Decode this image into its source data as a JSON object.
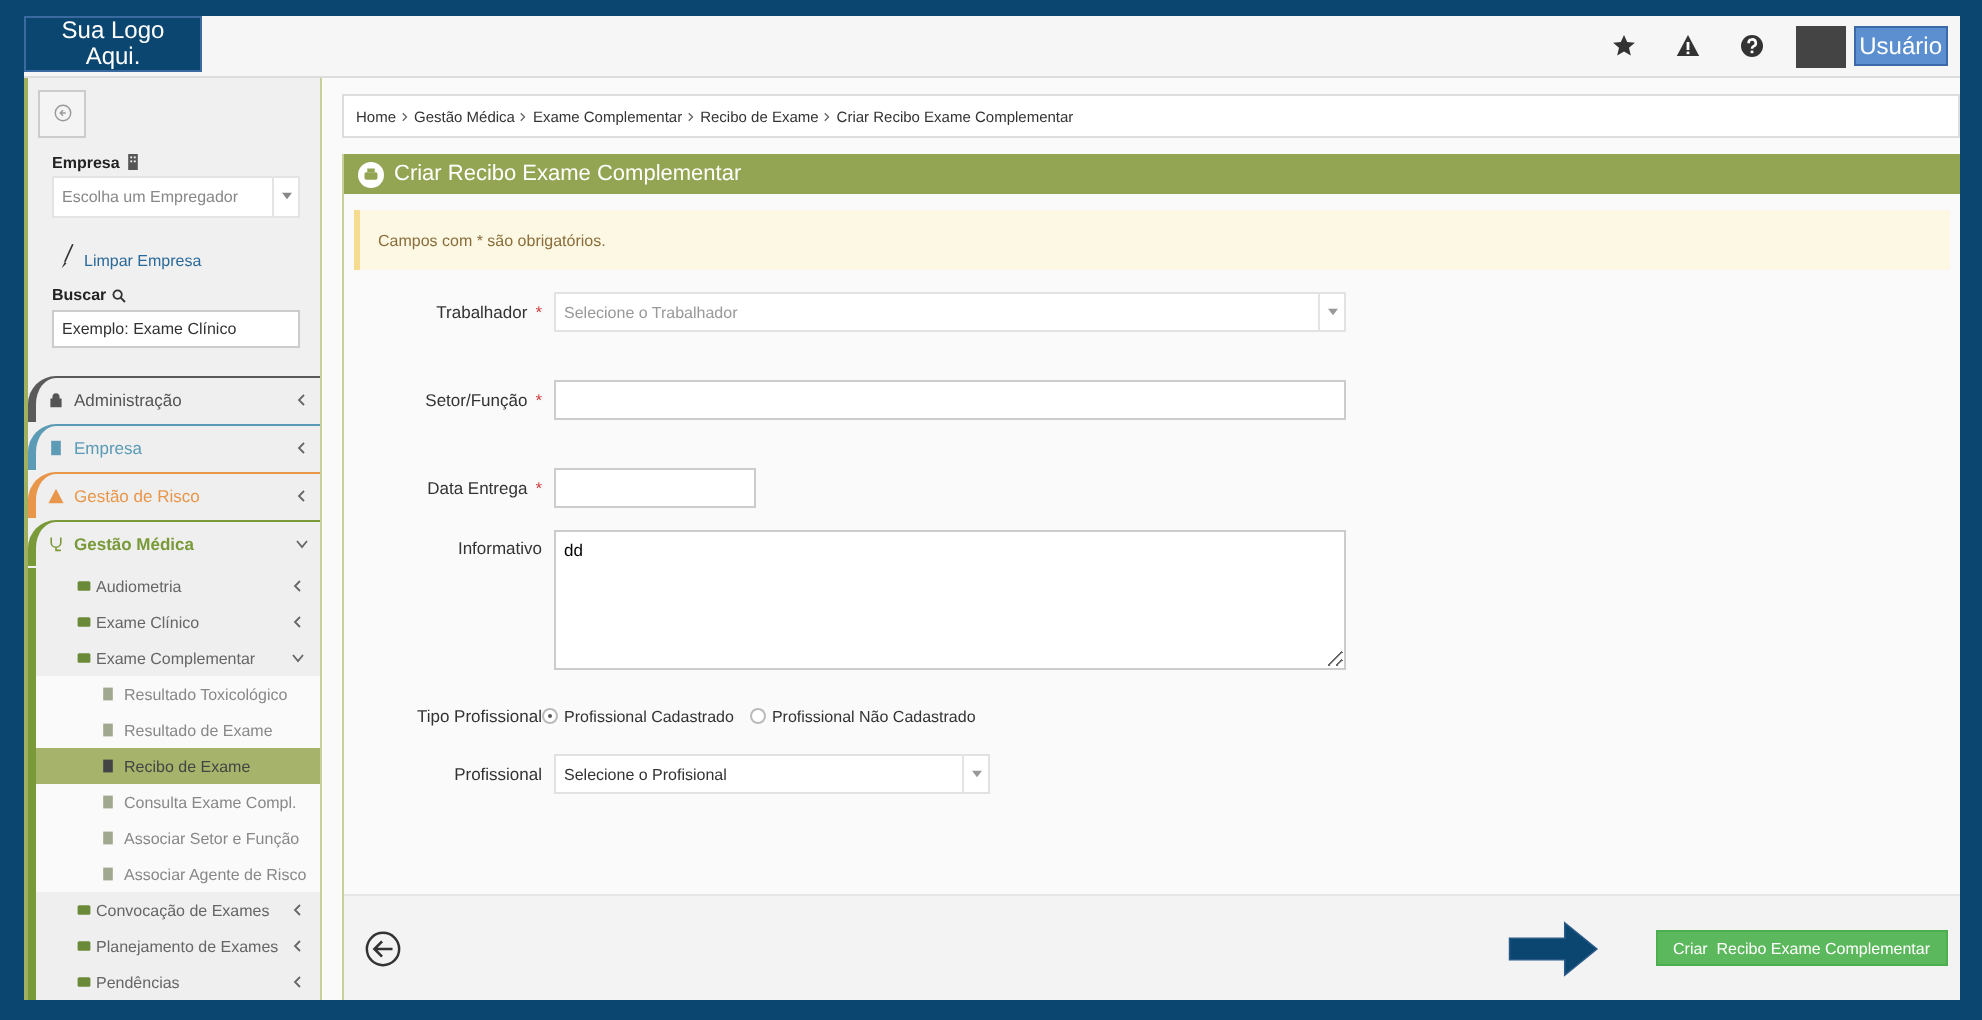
{
  "header": {
    "logo_text": "Sua Logo Aqui.",
    "user_button": "Usuário"
  },
  "sidebar": {
    "company_label": "Empresa",
    "company_select": {
      "placeholder": "Escolha um Empregador"
    },
    "clear_link": "Limpar Empresa",
    "search_label": "Buscar",
    "search": {
      "placeholder": "Exemplo: Exame Clínico"
    },
    "menu": [
      {
        "label": "Administração",
        "color": "#5a5a5a",
        "expanded": false
      },
      {
        "label": "Empresa",
        "color": "#5b9bb5",
        "expanded": false
      },
      {
        "label": "Gestão de Risco",
        "color": "#e8964a",
        "expanded": false
      },
      {
        "label": "Gestão Médica",
        "color": "#7a9a3a",
        "expanded": true,
        "children": [
          {
            "label": "Audiometria",
            "expanded": false
          },
          {
            "label": "Exame Clínico",
            "expanded": false
          },
          {
            "label": "Exame Complementar",
            "expanded": true,
            "children": [
              {
                "label": "Resultado Toxicológico",
                "selected": false
              },
              {
                "label": "Resultado de Exame",
                "selected": false
              },
              {
                "label": "Recibo de Exame",
                "selected": true
              },
              {
                "label": "Consulta Exame Compl.",
                "selected": false
              },
              {
                "label": "Associar Setor e Função",
                "selected": false
              },
              {
                "label": "Associar Agente de Risco",
                "selected": false
              }
            ]
          },
          {
            "label": "Convocação de Exames",
            "expanded": false
          },
          {
            "label": "Planejamento de Exames",
            "expanded": false
          },
          {
            "label": "Pendências",
            "expanded": false
          }
        ]
      }
    ]
  },
  "breadcrumb": [
    "Home",
    "Gestão Médica",
    "Exame Complementar",
    "Recibo de Exame",
    "Criar Recibo Exame Complementar"
  ],
  "panel_title": "Criar Recibo Exame Complementar",
  "alert": "Campos com * são obrigatórios.",
  "form": [
    {
      "kind": "select",
      "label": "Trabalhador",
      "required_mark": "*",
      "placeholder": "Selecione o Trabalhador"
    },
    {
      "kind": "text",
      "label": "Setor/Função",
      "required_mark": "*"
    },
    {
      "kind": "date",
      "label": "Data Entrega",
      "required_mark": "*"
    },
    {
      "kind": "textarea",
      "label": "Informativo",
      "value": "dd"
    },
    {
      "kind": "radio",
      "label": "Tipo Profissional",
      "options": [
        {
          "label": "Profissional Cadastrado",
          "selected": true
        },
        {
          "label": "Profissional Não Cadastrado",
          "selected": false
        }
      ]
    },
    {
      "kind": "select_small",
      "label": "Profissional",
      "value": "Selecione o Profisional"
    }
  ],
  "submit_button": "Criar  Recibo Exame Complementar"
}
